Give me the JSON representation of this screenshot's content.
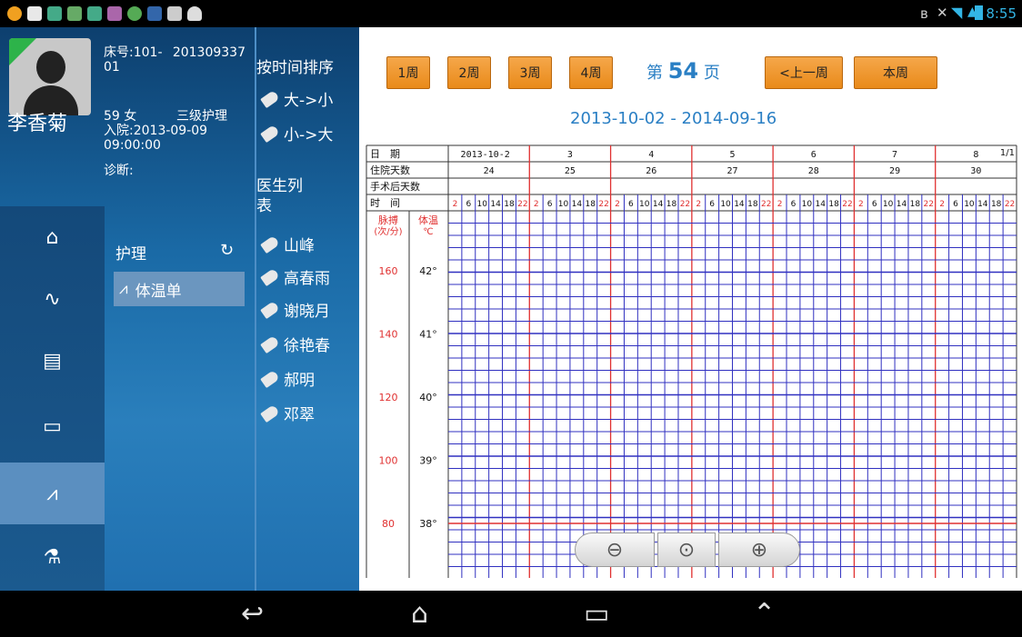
{
  "status_bar": {
    "time": "8:55"
  },
  "patient": {
    "name": "李香菊",
    "bed_label": "床号:101-01",
    "bed_id": "201309337",
    "age_sex": "59 女",
    "care_level": "三级护理",
    "admission": "入院:2013-09-09 09:00:00",
    "diagnosis": "诊断:"
  },
  "section": {
    "title": "护理",
    "menu_item": "体温单"
  },
  "sort": {
    "header": "按时间排序",
    "options": [
      "大->小",
      "小->大"
    ]
  },
  "doctors": {
    "header": "医生列表",
    "items": [
      "山峰",
      "高春雨",
      "谢晓月",
      "徐艳春",
      "郝明",
      "邓翠"
    ]
  },
  "week_buttons": [
    "1周",
    "2周",
    "3周",
    "4周"
  ],
  "page": {
    "prefix": "第",
    "number": "54",
    "suffix": "页"
  },
  "nav_buttons": {
    "prev_week": "<上一周",
    "this_week": "本周"
  },
  "date_range": "2013-10-02  -  2014-09-16",
  "chart_data": {
    "type": "table",
    "page_fraction": "1/1",
    "row_labels": [
      "日　期",
      "住院天数",
      "手术后天数",
      "时　间"
    ],
    "dates": [
      "2013-10-2",
      "3",
      "4",
      "5",
      "6",
      "7",
      "8"
    ],
    "hospital_days": [
      "24",
      "25",
      "26",
      "27",
      "28",
      "29",
      "30"
    ],
    "time_slots": [
      "2",
      "6",
      "10",
      "14",
      "18",
      "22"
    ],
    "pulse_label": "脉搏(次/分)",
    "temp_label": "体温℃",
    "pulse_ticks": [
      "160",
      "140",
      "120",
      "100",
      "80"
    ],
    "temp_ticks": [
      "42°",
      "41°",
      "40°",
      "39°",
      "38°"
    ],
    "colors": {
      "grid": "#3030c0",
      "day_divider": "#e03030",
      "red_text": "#e03030"
    }
  }
}
